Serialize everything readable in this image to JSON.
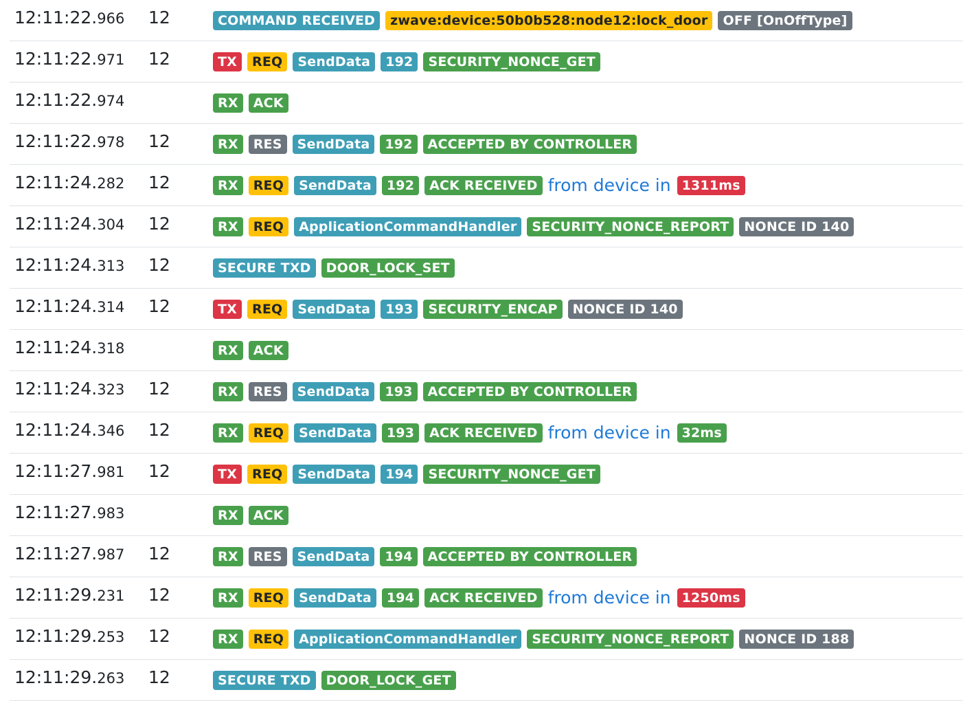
{
  "colors": {
    "red": "#dc3545",
    "yellow": "#ffc107",
    "cyan": "#3e9eb6",
    "green": "#49a04c",
    "gray": "#6c757d",
    "link": "#1e7ad8"
  },
  "rows": [
    {
      "time": "12:11:22.",
      "ms": "966",
      "node": "12",
      "items": [
        {
          "t": "COMMAND RECEIVED",
          "c": "cyan"
        },
        {
          "t": "zwave:device:50b0b528:node12:lock_door",
          "c": "yellow"
        },
        {
          "t": "OFF [OnOffType]",
          "c": "gray"
        }
      ]
    },
    {
      "time": "12:11:22.",
      "ms": "971",
      "node": "12",
      "items": [
        {
          "t": "TX",
          "c": "red"
        },
        {
          "t": "REQ",
          "c": "yellow"
        },
        {
          "t": "SendData",
          "c": "cyan"
        },
        {
          "t": "192",
          "c": "cyan"
        },
        {
          "t": "SECURITY_NONCE_GET",
          "c": "green"
        }
      ]
    },
    {
      "time": "12:11:22.",
      "ms": "974",
      "node": "",
      "items": [
        {
          "t": "RX",
          "c": "green"
        },
        {
          "t": "ACK",
          "c": "green"
        }
      ]
    },
    {
      "time": "12:11:22.",
      "ms": "978",
      "node": "12",
      "items": [
        {
          "t": "RX",
          "c": "green"
        },
        {
          "t": "RES",
          "c": "gray"
        },
        {
          "t": "SendData",
          "c": "cyan"
        },
        {
          "t": "192",
          "c": "green"
        },
        {
          "t": "ACCEPTED BY CONTROLLER",
          "c": "green"
        }
      ]
    },
    {
      "time": "12:11:24.",
      "ms": "282",
      "node": "12",
      "items": [
        {
          "t": "RX",
          "c": "green"
        },
        {
          "t": "REQ",
          "c": "yellow"
        },
        {
          "t": "SendData",
          "c": "cyan"
        },
        {
          "t": "192",
          "c": "green"
        },
        {
          "t": "ACK RECEIVED",
          "c": "green"
        },
        {
          "t": "from device in",
          "c": "text"
        },
        {
          "t": "1311ms",
          "c": "red"
        }
      ]
    },
    {
      "time": "12:11:24.",
      "ms": "304",
      "node": "12",
      "items": [
        {
          "t": "RX",
          "c": "green"
        },
        {
          "t": "REQ",
          "c": "yellow"
        },
        {
          "t": "ApplicationCommandHandler",
          "c": "cyan"
        },
        {
          "t": "SECURITY_NONCE_REPORT",
          "c": "green"
        },
        {
          "t": "NONCE ID 140",
          "c": "gray"
        }
      ]
    },
    {
      "time": "12:11:24.",
      "ms": "313",
      "node": "12",
      "items": [
        {
          "t": "SECURE TXD",
          "c": "cyan"
        },
        {
          "t": "DOOR_LOCK_SET",
          "c": "green"
        }
      ]
    },
    {
      "time": "12:11:24.",
      "ms": "314",
      "node": "12",
      "items": [
        {
          "t": "TX",
          "c": "red"
        },
        {
          "t": "REQ",
          "c": "yellow"
        },
        {
          "t": "SendData",
          "c": "cyan"
        },
        {
          "t": "193",
          "c": "cyan"
        },
        {
          "t": "SECURITY_ENCAP",
          "c": "green"
        },
        {
          "t": "NONCE ID 140",
          "c": "gray"
        }
      ]
    },
    {
      "time": "12:11:24.",
      "ms": "318",
      "node": "",
      "items": [
        {
          "t": "RX",
          "c": "green"
        },
        {
          "t": "ACK",
          "c": "green"
        }
      ]
    },
    {
      "time": "12:11:24.",
      "ms": "323",
      "node": "12",
      "items": [
        {
          "t": "RX",
          "c": "green"
        },
        {
          "t": "RES",
          "c": "gray"
        },
        {
          "t": "SendData",
          "c": "cyan"
        },
        {
          "t": "193",
          "c": "green"
        },
        {
          "t": "ACCEPTED BY CONTROLLER",
          "c": "green"
        }
      ]
    },
    {
      "time": "12:11:24.",
      "ms": "346",
      "node": "12",
      "items": [
        {
          "t": "RX",
          "c": "green"
        },
        {
          "t": "REQ",
          "c": "yellow"
        },
        {
          "t": "SendData",
          "c": "cyan"
        },
        {
          "t": "193",
          "c": "green"
        },
        {
          "t": "ACK RECEIVED",
          "c": "green"
        },
        {
          "t": "from device in",
          "c": "text"
        },
        {
          "t": "32ms",
          "c": "green"
        }
      ]
    },
    {
      "time": "12:11:27.",
      "ms": "981",
      "node": "12",
      "items": [
        {
          "t": "TX",
          "c": "red"
        },
        {
          "t": "REQ",
          "c": "yellow"
        },
        {
          "t": "SendData",
          "c": "cyan"
        },
        {
          "t": "194",
          "c": "cyan"
        },
        {
          "t": "SECURITY_NONCE_GET",
          "c": "green"
        }
      ]
    },
    {
      "time": "12:11:27.",
      "ms": "983",
      "node": "",
      "items": [
        {
          "t": "RX",
          "c": "green"
        },
        {
          "t": "ACK",
          "c": "green"
        }
      ]
    },
    {
      "time": "12:11:27.",
      "ms": "987",
      "node": "12",
      "items": [
        {
          "t": "RX",
          "c": "green"
        },
        {
          "t": "RES",
          "c": "gray"
        },
        {
          "t": "SendData",
          "c": "cyan"
        },
        {
          "t": "194",
          "c": "green"
        },
        {
          "t": "ACCEPTED BY CONTROLLER",
          "c": "green"
        }
      ]
    },
    {
      "time": "12:11:29.",
      "ms": "231",
      "node": "12",
      "items": [
        {
          "t": "RX",
          "c": "green"
        },
        {
          "t": "REQ",
          "c": "yellow"
        },
        {
          "t": "SendData",
          "c": "cyan"
        },
        {
          "t": "194",
          "c": "green"
        },
        {
          "t": "ACK RECEIVED",
          "c": "green"
        },
        {
          "t": "from device in",
          "c": "text"
        },
        {
          "t": "1250ms",
          "c": "red"
        }
      ]
    },
    {
      "time": "12:11:29.",
      "ms": "253",
      "node": "12",
      "items": [
        {
          "t": "RX",
          "c": "green"
        },
        {
          "t": "REQ",
          "c": "yellow"
        },
        {
          "t": "ApplicationCommandHandler",
          "c": "cyan"
        },
        {
          "t": "SECURITY_NONCE_REPORT",
          "c": "green"
        },
        {
          "t": "NONCE ID 188",
          "c": "gray"
        }
      ]
    },
    {
      "time": "12:11:29.",
      "ms": "263",
      "node": "12",
      "items": [
        {
          "t": "SECURE TXD",
          "c": "cyan"
        },
        {
          "t": "DOOR_LOCK_GET",
          "c": "green"
        }
      ]
    }
  ]
}
